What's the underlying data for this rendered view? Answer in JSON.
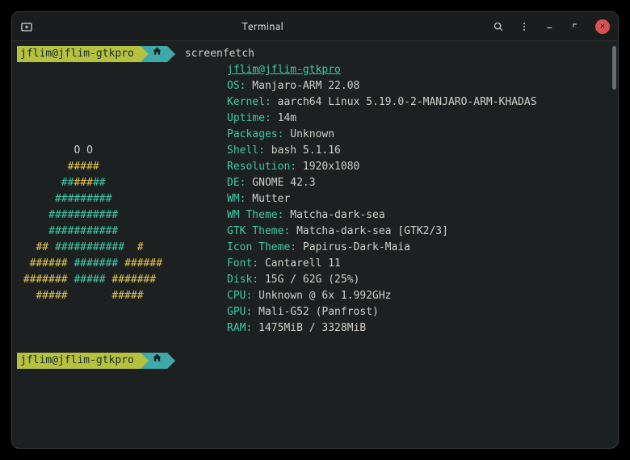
{
  "titlebar": {
    "title": "Terminal"
  },
  "prompt": {
    "user_host": "jflim@jflim-gtkpro",
    "path_icon": "⌂",
    "cmd": "screenfetch"
  },
  "ascii": {
    "l1": "",
    "l2": "",
    "l3": "",
    "l4": "",
    "l5": "",
    "l6_o": "         O O",
    "l7": "        #####",
    "l8a": "       ##",
    "l8b": "###",
    "l8c": "##",
    "l9": "      #########",
    "l10": "     ###########",
    "l11": "     ###########",
    "l12a": "   ## ",
    "l12b": "###########",
    "l12c": "  #",
    "l13a": "  ###### ",
    "l13b": "#######",
    "l13c": " ######",
    "l14a": " ####### ",
    "l14b": "#####",
    "l14c": " #######",
    "l15a": "   #####",
    "l15b": "       ",
    "l15c": "#####"
  },
  "info": {
    "user_host": "jflim@jflim-gtkpro",
    "os_k": "OS:",
    "os_v": " Manjaro-ARM 22.08",
    "kernel_k": "Kernel:",
    "kernel_v": " aarch64 Linux 5.19.0-2-MANJARO-ARM-KHADAS",
    "uptime_k": "Uptime:",
    "uptime_v": " 14m",
    "packages_k": "Packages:",
    "packages_v": " Unknown",
    "shell_k": "Shell:",
    "shell_v": " bash 5.1.16",
    "resolution_k": "Resolution:",
    "resolution_v": " 1920x1080",
    "de_k": "DE:",
    "de_v": " GNOME 42.3",
    "wm_k": "WM:",
    "wm_v": " Mutter",
    "wmtheme_k": "WM Theme:",
    "wmtheme_v": " Matcha-dark-sea",
    "gtktheme_k": "GTK Theme:",
    "gtktheme_v": " Matcha-dark-sea [GTK2/3]",
    "icontheme_k": "Icon Theme:",
    "icontheme_v": " Papirus-Dark-Maia",
    "font_k": "Font:",
    "font_v": " Cantarell 11",
    "disk_k": "Disk:",
    "disk_v": " 15G / 62G (25%)",
    "cpu_k": "CPU:",
    "cpu_v": " Unknown @ 6x 1.992GHz",
    "gpu_k": "GPU:",
    "gpu_v": " Mali-G52 (Panfrost)",
    "ram_k": "RAM:",
    "ram_v": " 1475MiB / 3328MiB"
  }
}
